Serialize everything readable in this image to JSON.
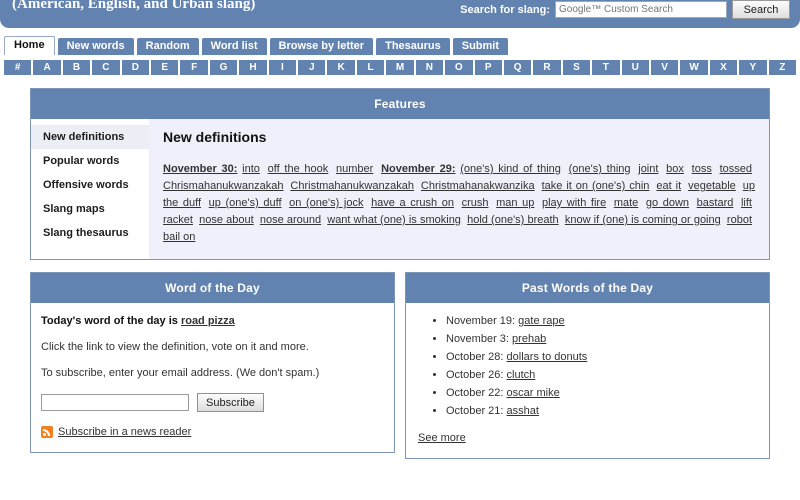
{
  "banner": {
    "title": "(American, English, and Urban slang)",
    "search_label": "Search for slang:",
    "search_placeholder": "Google™ Custom Search",
    "search_value": "",
    "search_button": "Search"
  },
  "tabs": [
    {
      "label": "Home",
      "active": true
    },
    {
      "label": "New words",
      "active": false
    },
    {
      "label": "Random",
      "active": false
    },
    {
      "label": "Word list",
      "active": false
    },
    {
      "label": "Browse by letter",
      "active": false
    },
    {
      "label": "Thesaurus",
      "active": false
    },
    {
      "label": "Submit",
      "active": false
    }
  ],
  "alphabet": [
    "#",
    "A",
    "B",
    "C",
    "D",
    "E",
    "F",
    "G",
    "H",
    "I",
    "J",
    "K",
    "L",
    "M",
    "N",
    "O",
    "P",
    "Q",
    "R",
    "S",
    "T",
    "U",
    "V",
    "W",
    "X",
    "Y",
    "Z"
  ],
  "features": {
    "header": "Features",
    "sidebar": [
      {
        "label": "New definitions",
        "selected": true
      },
      {
        "label": "Popular words",
        "selected": false
      },
      {
        "label": "Offensive words",
        "selected": false
      },
      {
        "label": "Slang maps",
        "selected": false
      },
      {
        "label": "Slang thesaurus",
        "selected": false
      }
    ],
    "content_title": "New definitions",
    "groups": [
      {
        "date": "November 30:",
        "terms": [
          "into",
          "off the hook",
          "number"
        ]
      },
      {
        "date": "November 29:",
        "terms": [
          "(one's) kind of thing",
          "(one's) thing",
          "joint",
          "box",
          "toss",
          "tossed",
          "Chrismahanukwanzakah",
          "Christmahanukwanzakah",
          "Christmahanakwanzika",
          "take it on (one's) chin",
          "eat it",
          "vegetable",
          "up the duff",
          "up (one's) duff",
          "on (one's) jock",
          "have a crush on",
          "crush",
          "man up",
          "play with fire",
          "mate",
          "go down",
          "bastard",
          "lift",
          "racket",
          "nose about",
          "nose around",
          "want what (one) is smoking",
          "hold (one's) breath",
          "know if (one) is coming or going",
          "robot",
          "bail on"
        ]
      }
    ]
  },
  "word_of_the_day": {
    "header": "Word of the Day",
    "intro_prefix": "Today's word of the day is ",
    "word": "road pizza",
    "description": "Click the link to view the definition, vote on it and more.",
    "subscribe_text": "To subscribe, enter your email address. (We don't spam.)",
    "email_value": "",
    "subscribe_button": "Subscribe",
    "rss_link": "Subscribe in a news reader"
  },
  "past_words": {
    "header": "Past Words of the Day",
    "items": [
      {
        "date": "November 19:",
        "word": "gate rape"
      },
      {
        "date": "November 3:",
        "word": "prehab"
      },
      {
        "date": "October 28:",
        "word": "dollars to donuts"
      },
      {
        "date": "October 26:",
        "word": "clutch"
      },
      {
        "date": "October 22:",
        "word": "oscar mike"
      },
      {
        "date": "October 21:",
        "word": "asshat"
      }
    ],
    "see_more": "See more"
  },
  "colors": {
    "header_blue": "#6283b0",
    "panel_border": "#7d95b8",
    "content_bg": "#f0f0fa",
    "sidebar_selected": "#eceef6",
    "rss_orange": "#f08020"
  }
}
